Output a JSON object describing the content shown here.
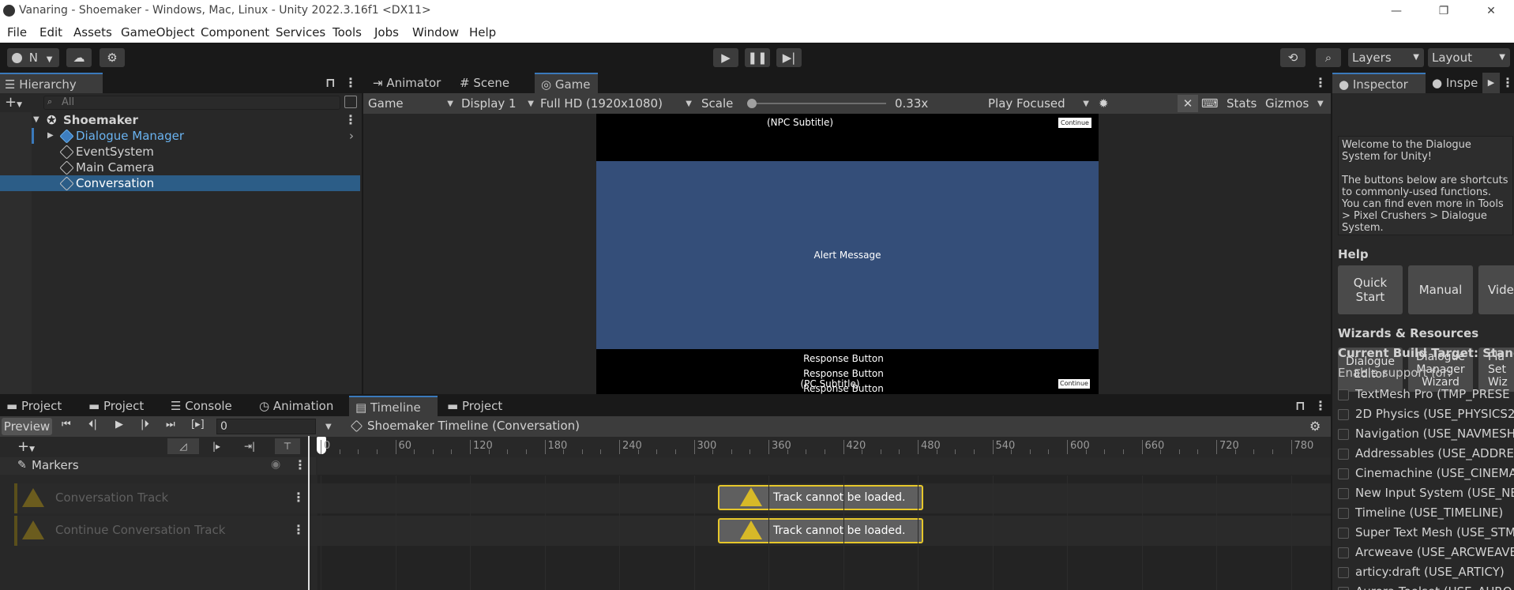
{
  "window": {
    "title": "Vanaring - Shoemaker - Windows, Mac, Linux - Unity 2022.3.16f1 <DX11>",
    "controls": [
      "—",
      "❐",
      "✕"
    ]
  },
  "menu": [
    "File",
    "Edit",
    "Assets",
    "GameObject",
    "Component",
    "Services",
    "Tools",
    "Jobs",
    "Window",
    "Help"
  ],
  "toolbar": {
    "account_initial": "N",
    "layers_label": "Layers",
    "layout_label": "Layout"
  },
  "hierarchy": {
    "tab_label": "Hierarchy",
    "search_placeholder": "All",
    "scene_name": "Shoemaker",
    "items": [
      {
        "label": "Dialogue Manager"
      },
      {
        "label": "EventSystem"
      },
      {
        "label": "Main Camera"
      },
      {
        "label": "Conversation"
      }
    ]
  },
  "center_tabs": [
    "Animator",
    "Scene",
    "Game"
  ],
  "game_toolbar": {
    "view": "Game",
    "display": "Display 1",
    "resolution": "Full HD (1920x1080)",
    "scale_label": "Scale",
    "scale_value": "0.33x",
    "scale_fraction": 0.0,
    "play_mode": "Play Focused",
    "stats": "Stats",
    "gizmos": "Gizmos"
  },
  "game_view": {
    "npc_subtitle": "(NPC Subtitle)",
    "continue_top": "Continue",
    "alert": "Alert Message",
    "response_1": "Response Button",
    "response_2": "Response Button",
    "response_3": "Response Button",
    "pc_subtitle": "(PC Subtitle)",
    "continue_bottom": "Continue"
  },
  "bottom_tabs": [
    "Project",
    "Project",
    "Console",
    "Animation",
    "Timeline",
    "Project"
  ],
  "timeline": {
    "preview": "Preview",
    "frame_value": "0",
    "asset": "Shoemaker Timeline (Conversation)",
    "ruler": [
      "0",
      "60",
      "120",
      "180",
      "240",
      "300",
      "360",
      "420",
      "480",
      "540",
      "600",
      "660",
      "720",
      "780"
    ],
    "markers_label": "Markers",
    "tracks": [
      {
        "label": "Conversation Track",
        "clip": "Track cannot be loaded."
      },
      {
        "label": "Continue Conversation Track",
        "clip": "Track cannot be loaded."
      }
    ]
  },
  "inspector": {
    "tab_label": "Inspector",
    "tab2_label": "Inspe",
    "welcome": "Welcome to the Dialogue System for Unity!",
    "desc": "The buttons below are shortcuts to commonly-used functions. You can find even more in Tools > Pixel Crushers > Dialogue System.",
    "help_title": "Help",
    "help_buttons": [
      "Quick Start",
      "Manual",
      "Vide"
    ],
    "wizards_title": "Wizards & Resources",
    "wizard_buttons": [
      "Dialogue Editor",
      "Dialogue Manager Wizard",
      "Pla Set Wiz"
    ],
    "build_target": "Current Build Target: Standa",
    "enable_support": "Enable support for:",
    "symbols": [
      "TextMesh Pro (TMP_PRESE",
      "2D Physics (USE_PHYSICS2",
      "Navigation (USE_NAVMESH",
      "Addressables (USE_ADDRES",
      "Cinemachine (USE_CINEMA",
      "New Input System (USE_NE",
      "Timeline (USE_TIMELINE)",
      "Super Text Mesh (USE_STM",
      "Arcweave (USE_ARCWEAVE",
      "articy:draft (USE_ARTICY)",
      "Aurora Toolset (USE_AURO"
    ]
  }
}
